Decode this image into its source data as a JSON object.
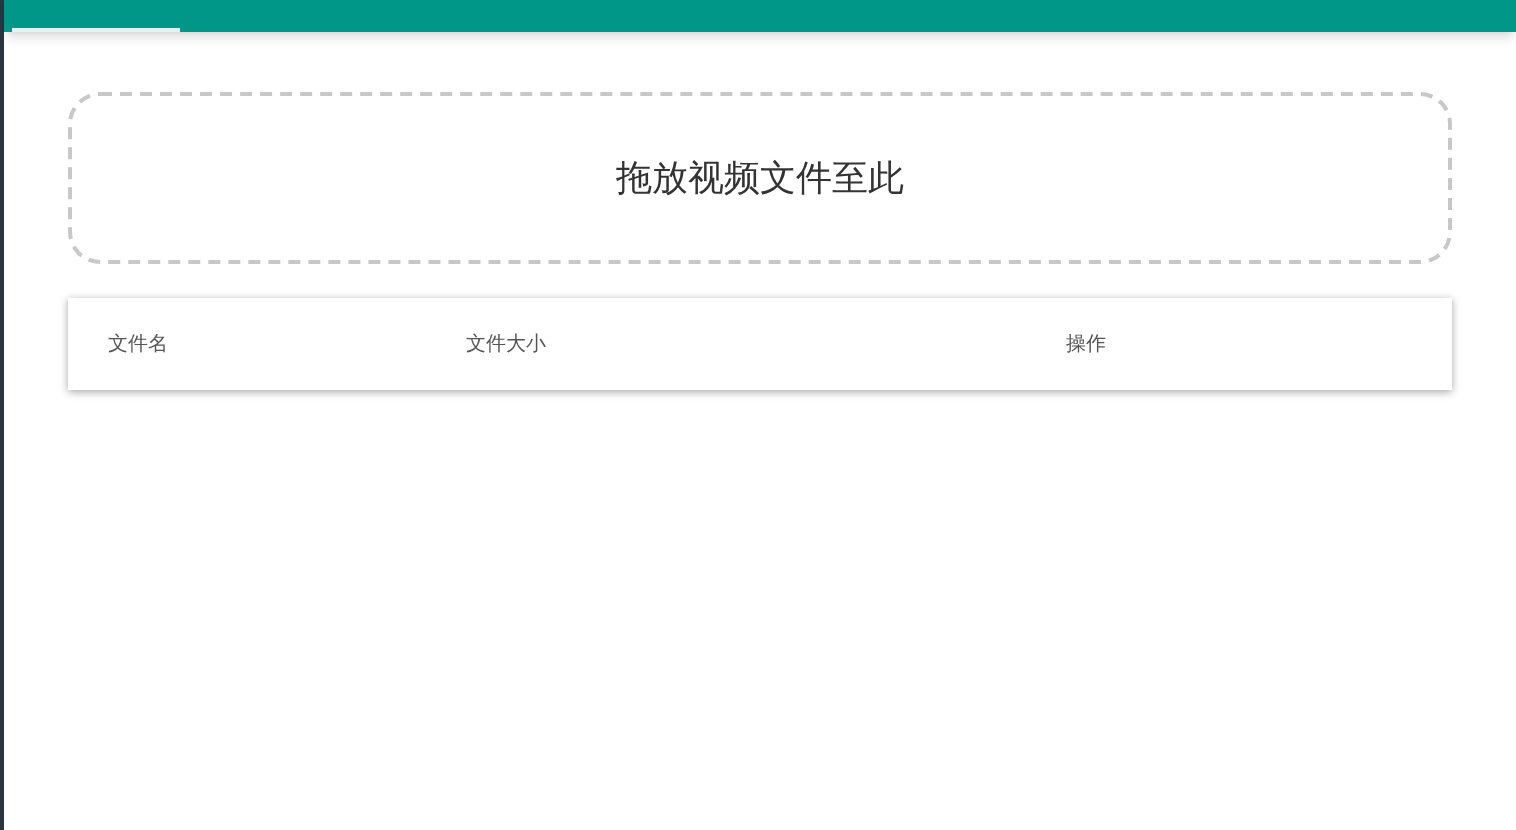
{
  "dropzone": {
    "label": "拖放视频文件至此"
  },
  "table": {
    "columns": [
      "文件名",
      "文件大小",
      "操作"
    ]
  }
}
